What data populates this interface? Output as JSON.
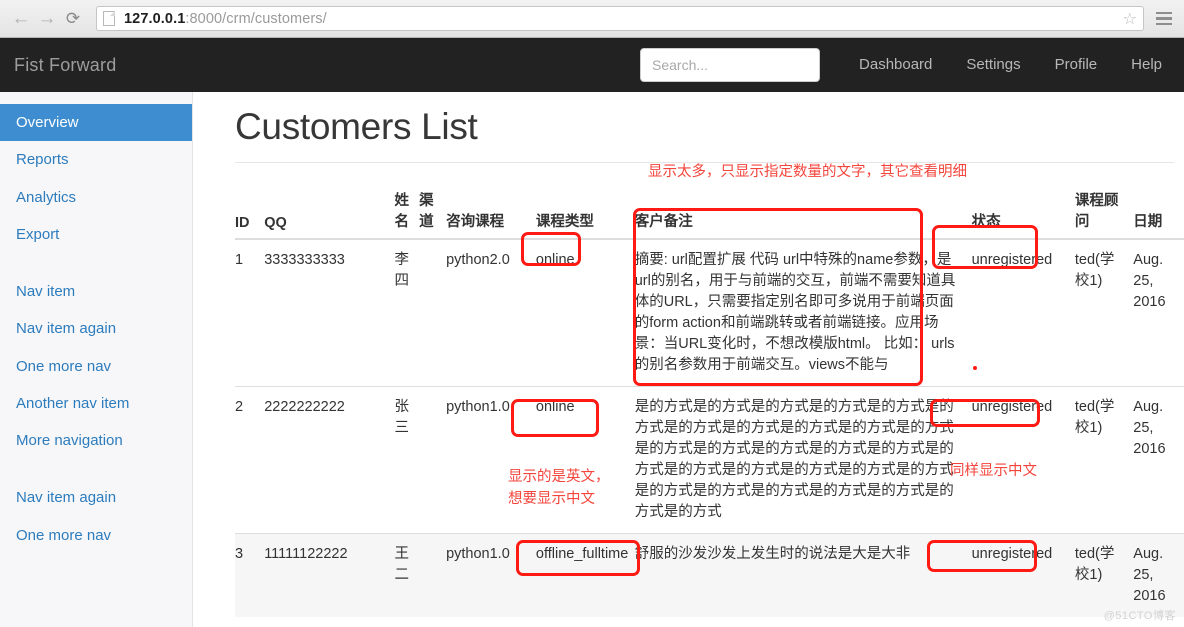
{
  "browser": {
    "back_icon": "←",
    "forward_icon": "→",
    "reload_icon": "⟳",
    "page_icon": "page-icon",
    "url_host": "127.0.0.1",
    "url_path": ":8000/crm/customers/",
    "star_icon": "☆",
    "menu_icon": "hamburger-menu-icon"
  },
  "navbar": {
    "brand": "Fist Forward",
    "search_placeholder": "Search...",
    "search_value": "",
    "links": [
      "Dashboard",
      "Settings",
      "Profile",
      "Help"
    ]
  },
  "sidebar": {
    "items": [
      {
        "label": "Overview",
        "active": true
      },
      {
        "label": "Reports",
        "active": false
      },
      {
        "label": "Analytics",
        "active": false
      },
      {
        "label": "Export",
        "active": false
      },
      {
        "label": "",
        "gap": true
      },
      {
        "label": "Nav item",
        "active": false
      },
      {
        "label": "Nav item again",
        "active": false
      },
      {
        "label": "One more nav",
        "active": false
      },
      {
        "label": "Another nav item",
        "active": false
      },
      {
        "label": "More navigation",
        "active": false
      },
      {
        "label": "",
        "gap": true
      },
      {
        "label": "Nav item again",
        "active": false
      },
      {
        "label": "One more nav",
        "active": false
      }
    ]
  },
  "main": {
    "title": "Customers List",
    "table": {
      "headers": [
        "ID",
        "QQ",
        "姓名",
        "渠道",
        "咨询课程",
        "课程类型",
        "客户备注",
        "状态",
        "课程顾问",
        "日期"
      ],
      "rows": [
        {
          "id": "1",
          "qq": "3333333333",
          "name": "李四",
          "channel": "",
          "course": "python2.0",
          "course_type": "online",
          "note": "摘要: url配置扩展 代码 url中特殊的name参数，是url的别名，用于与前端的交互，前端不需要知道具体的URL，只需要指定别名即可多说用于前端页面的form action和前端跳转或者前端链接。应用场景：当URL变化时，不想改模版html。 比如： urls的别名参数用于前端交互。views不能与",
          "status": "unregistered",
          "advisor": "ted(学校1)",
          "date": "Aug. 25, 2016"
        },
        {
          "id": "2",
          "qq": "2222222222",
          "name": "张三",
          "channel": "",
          "course": "python1.0",
          "course_type": "online",
          "note": "是的方式是的方式是的方式是的方式是的方式是的方式是的方式是的方式是的方式是的方式是的方式是的方式是的方式是的方式是的方式是的方式是的方式是的方式是的方式是的方式是的方式是的方式是的方式是的方式是的方式是的方式是的方式是的方式是的方式",
          "status": "unregistered",
          "advisor": "ted(学校1)",
          "date": "Aug. 25, 2016"
        },
        {
          "id": "3",
          "qq": "11111122222",
          "name": "王二",
          "channel": "",
          "course": "python1.0",
          "course_type": "offline_fulltime",
          "note": "舒服的沙发沙发上发生时的说法是大是大非",
          "status": "unregistered",
          "advisor": "ted(学校1)",
          "date": "Aug. 25, 2016"
        }
      ]
    }
  },
  "annotations": {
    "note_too_long": "显示太多，只显示指定数量的文字，其它查看明细",
    "english_wanted_chinese": "显示的是英文，\n想要显示中文",
    "also_show_chinese": "同样显示中文"
  },
  "watermark": "@51CTO博客",
  "colors": {
    "accent": "#3d8dd0",
    "link": "#2c7cbd",
    "annotation_red": "#f4453c",
    "navbar_bg": "#222222",
    "sidebar_bg": "#f7f7f9"
  }
}
